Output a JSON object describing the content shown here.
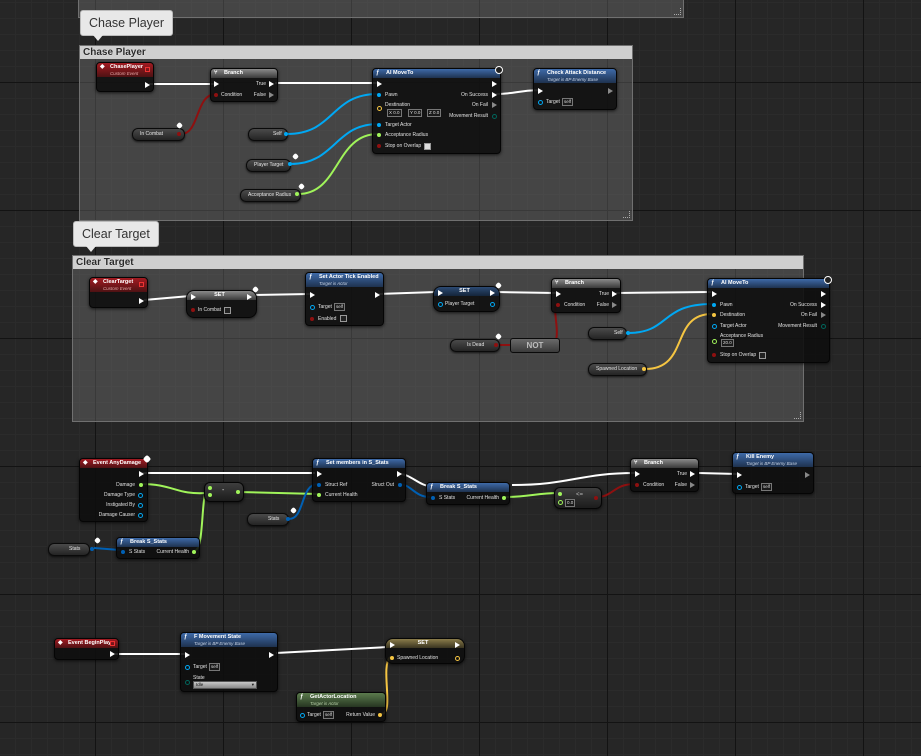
{
  "colors": {
    "exec": "#ffffff",
    "bool": "#8e1010",
    "object": "#00a8f4",
    "float": "#a0f45a",
    "vector": "#f5c542",
    "struct": "#0060b4",
    "enum": "#00665c"
  },
  "comments": {
    "chase": {
      "bubble": "Chase Player",
      "title": "Chase Player"
    },
    "clear": {
      "bubble": "Clear Target",
      "title": "Clear Target"
    }
  },
  "chase": {
    "event": {
      "title": "ChasePlayer",
      "sub": "Custom Event"
    },
    "branch": {
      "title": "Branch",
      "condition": "Condition",
      "true": "True",
      "false": "False"
    },
    "incombat": "In Combat",
    "self": "Self",
    "playertarget": "Player Target",
    "acceptance": "Acceptance Radius",
    "moveto": {
      "title": "AI MoveTo",
      "pawn": "Pawn",
      "destination": "Destination",
      "dx": "0.0",
      "dy": "0.0",
      "dz": "0.0",
      "targetactor": "Target Actor",
      "acceptance": "Acceptance Radius",
      "stop": "Stop on Overlap",
      "success": "On Success",
      "fail": "On Fail",
      "result": "Movement Result"
    },
    "check": {
      "title": "Check Attack Distance",
      "sub": "Target is BP Enemy Base",
      "target": "Target",
      "self": "self"
    }
  },
  "clear": {
    "event": {
      "title": "ClearTarget",
      "sub": "Custom Event"
    },
    "set": {
      "title": "SET",
      "incombat": "In Combat"
    },
    "tick": {
      "title": "Set Actor Tick Enabled",
      "sub": "Target is Actor",
      "target": "Target",
      "self": "self",
      "enabled": "Enabled"
    },
    "setpt": {
      "title": "SET",
      "pt": "Player Target"
    },
    "branch": {
      "title": "Branch",
      "condition": "Condition",
      "true": "True",
      "false": "False"
    },
    "isdead": "Is Dead",
    "not": "NOT",
    "self": "Self",
    "spawned": "Spawned Location",
    "moveto": {
      "title": "AI MoveTo",
      "pawn": "Pawn",
      "destination": "Destination",
      "targetactor": "Target Actor",
      "acceptance": "Acceptance Radius",
      "accval": "20.0",
      "stop": "Stop on Overlap",
      "success": "On Success",
      "fail": "On Fail",
      "result": "Movement Result"
    }
  },
  "damage": {
    "event": {
      "title": "Event AnyDamage",
      "damage": "Damage",
      "type": "Damage Type",
      "instigated": "Instigated By",
      "causer": "Damage Causer"
    },
    "minus": "-",
    "stats1": "Stats",
    "stats2": "Stats",
    "break1": {
      "title": "Break S_Stats",
      "sstats": "S Stats",
      "ch": "Current Health"
    },
    "setmembers": {
      "title": "Set members in S_Stats",
      "structref": "Struct Ref",
      "structout": "Struct Out",
      "ch": "Current Health"
    },
    "break2": {
      "title": "Break S_Stats",
      "sstats": "S Stats",
      "ch": "Current Health"
    },
    "compare": {
      "op": "<=",
      "val": "0.0"
    },
    "branch": {
      "title": "Branch",
      "condition": "Condition",
      "true": "True",
      "false": "False"
    },
    "kill": {
      "title": "Kill Enemy",
      "sub": "Target is BP Enemy Base",
      "target": "Target",
      "self": "self"
    }
  },
  "begin": {
    "event": {
      "title": "Event BeginPlay"
    },
    "fmove": {
      "title": "F Movement State",
      "sub": "Target is BP Enemy Base",
      "target": "Target",
      "self": "self",
      "state": "State",
      "stateval": "Idle"
    },
    "set": {
      "title": "SET",
      "spawned": "Spawned Location"
    },
    "getloc": {
      "title": "GetActorLocation",
      "sub": "Target is Actor",
      "target": "Target",
      "self": "self",
      "ret": "Return Value"
    }
  }
}
